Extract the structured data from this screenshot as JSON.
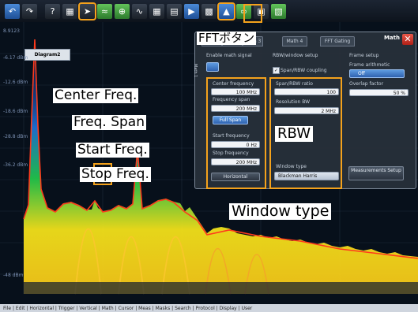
{
  "toolbar": {
    "icons": [
      "back-icon",
      "forward-icon",
      "help-icon",
      "grid-icon",
      "cursor-icon",
      "measure-icon",
      "zoom-icon",
      "waveform-icon",
      "table-icon",
      "history-icon",
      "mask-icon",
      "bus-icon",
      "fft-icon",
      "ratio-icon",
      "camera-icon",
      "power-icon"
    ]
  },
  "plot": {
    "tab_label": "Diagram2",
    "ref_label": "8.9123",
    "y_labels": [
      "8.91",
      "-6.17 dBm",
      "-12.6 dBm",
      "-18.6 dBm",
      "-28.8 dBm",
      "-36.2 dBm",
      "-48 dBm"
    ],
    "colors": {
      "trace": "#ff3a1c",
      "spectrum_hot": "#ffe200",
      "spectrum_mid": "#26c43c",
      "spectrum_cold": "#1a3fa8"
    }
  },
  "menubar": {
    "items": [
      "File",
      "Edit",
      "Horizontal",
      "Trigger",
      "Vertical",
      "Math",
      "Cursor",
      "Meas",
      "Masks",
      "Search",
      "Protocol",
      "Display",
      "User"
    ]
  },
  "dialog": {
    "title": "Math",
    "tabs": [
      "Setup",
      "Math 2",
      "Math 3",
      "Math 4",
      "FFT Gating"
    ],
    "side_tab": "Math 1",
    "enable_label": "Enable math signal",
    "rbw_section": "RBW/window setup",
    "span_rbw_coupling": "Span/RBW coupling",
    "frame_setup": "Frame setup",
    "frame_arith_label": "Frame arithmetic",
    "frame_arith_value": "Off",
    "overlap_label": "Overlap factor",
    "overlap_value": "50 %",
    "center_label": "Center frequency",
    "center_value": "100 MHz",
    "span_label": "Frequency span",
    "span_value": "200 MHz",
    "full_span": "Full Span",
    "start_label": "Start frequency",
    "start_value": "0 Hz",
    "stop_label": "Stop frequency",
    "stop_value": "200 MHz",
    "span_rbw_ratio_label": "Span/RBW ratio",
    "span_rbw_ratio_value": "100",
    "resbw_label": "Resolution BW",
    "resbw_value": "2 MHz",
    "window_label": "Window type",
    "window_value": "Blackman Harris",
    "horizontal_btn": "Horizontal",
    "measurements_btn": "Measurements Setup"
  },
  "annotations": {
    "fft_button": "FFTボタン",
    "center": "Center Freq.",
    "span": "Freq. Span",
    "start": "Start Freq.",
    "stop": "Stop Freq.",
    "rbw": "RBW",
    "window": "Window type"
  }
}
